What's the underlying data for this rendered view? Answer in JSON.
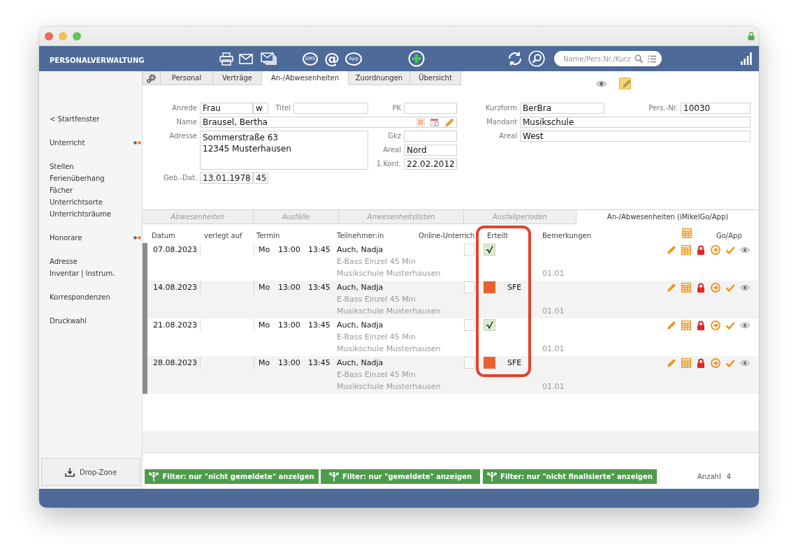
{
  "header": {
    "title": "PERSONALVERWALTUNG",
    "sms_label": "SMS",
    "at_symbol": "@",
    "app_label": "App",
    "search": {
      "placeholder": "Name/Pers.Nr./Kurz"
    }
  },
  "tabs": [
    {
      "label": "Personal",
      "selected": false
    },
    {
      "label": "Verträge",
      "selected": false
    },
    {
      "label": "An-/Abwesenheiten",
      "selected": true
    },
    {
      "label": "Zuordnungen",
      "selected": false
    },
    {
      "label": "Übersicht",
      "selected": false
    }
  ],
  "form": {
    "anrede": {
      "label": "Anrede",
      "value": "Frau"
    },
    "geschlecht": {
      "value": "w"
    },
    "titel": {
      "label": "Titel"
    },
    "pk": {
      "label": "PK"
    },
    "kurzform": {
      "label": "Kurzform",
      "value": "BerBra"
    },
    "pers_nr": {
      "label": "Pers.-Nr.",
      "value": "10030"
    },
    "name": {
      "label": "Name",
      "value": "Brausel, Bertha"
    },
    "mandant": {
      "label": "Mandant",
      "value": "Musikschule"
    },
    "adresse": {
      "label": "Adresse",
      "lines": [
        "Sommerstraße 63",
        "12345 Musterhausen"
      ]
    },
    "gkz": {
      "label": "Gkz"
    },
    "areal": {
      "label": "Areal",
      "value": "Nord"
    },
    "areal_2": {
      "label": "Areal",
      "value": "West"
    },
    "erster_kontakt": {
      "label": "1.Kont.",
      "value": "22.02.2012"
    },
    "geburtsdatum": {
      "label": "Geb.-Dat.",
      "value": "13.01.1978"
    },
    "alter": {
      "value": "45"
    }
  },
  "sidebar": {
    "groups": [
      [
        {
          "label": "< Startfenster",
          "dots": false
        }
      ],
      [
        {
          "label": "Unterricht",
          "dots": true
        }
      ],
      [
        {
          "label": "Stellen",
          "dots": false
        },
        {
          "label": "Ferienüberhang",
          "dots": false
        },
        {
          "label": "Fächer",
          "dots": false
        },
        {
          "label": "Unterrichtsorte",
          "dots": false
        },
        {
          "label": "Unterrichtsräume",
          "dots": false
        }
      ],
      [
        {
          "label": "Honorare",
          "dots": true
        }
      ],
      [
        {
          "label": "Adresse",
          "dots": false
        },
        {
          "label": "Inventar | Instrum.",
          "dots": false
        }
      ],
      [
        {
          "label": "Korrespondenzen",
          "dots": false
        }
      ],
      [
        {
          "label": "Druckwahl",
          "dots": false
        }
      ]
    ],
    "drop_zone": "Drop-Zone"
  },
  "subtabs": [
    {
      "label": "Abwesenheiten",
      "selected": false
    },
    {
      "label": "Ausfälle",
      "selected": false
    },
    {
      "label": "Anwesenheitslisten",
      "selected": false
    },
    {
      "label": "Ausfallperioden",
      "selected": false
    },
    {
      "label": "An-/Abwesenheiten (iMikelGo/App)",
      "selected": true
    }
  ],
  "table": {
    "columns": [
      "Datum",
      "verlegt auf",
      "Termin",
      "Teilnehmer:in",
      "Online-Unterrich",
      "Erteilt",
      "Bemerkungen",
      "Go/App"
    ],
    "rows": [
      {
        "date": "07.08.2023",
        "weekday": "Mo",
        "start": "13:00",
        "end": "13:45",
        "participant": "Auch, Nadja",
        "course": "E-Bass Einzel 45 Min",
        "location": "Musikschule Musterhausen",
        "online": false,
        "erteilt": true,
        "remark": "01.01"
      },
      {
        "date": "14.08.2023",
        "weekday": "Mo",
        "start": "13:00",
        "end": "13:45",
        "participant": "Auch, Nadja",
        "course": "E-Bass Einzel 45 Min",
        "location": "Musikschule Musterhausen",
        "online": false,
        "erteilt": false,
        "code": "SFE",
        "remark": "01.01"
      },
      {
        "date": "21.08.2023",
        "weekday": "Mo",
        "start": "13:00",
        "end": "13:45",
        "participant": "Auch, Nadja",
        "course": "E-Bass Einzel 45 Min",
        "location": "Musikschule Musterhausen",
        "online": false,
        "erteilt": true,
        "remark": "01.01"
      },
      {
        "date": "28.08.2023",
        "weekday": "Mo",
        "start": "13:00",
        "end": "13:45",
        "participant": "Auch, Nadja",
        "course": "E-Bass Einzel 45 Min",
        "location": "Musikschule Musterhausen",
        "online": false,
        "erteilt": false,
        "code": "SFE",
        "remark": "01.01"
      }
    ]
  },
  "filters": [
    "Filter: nur \"nicht gemeldete\" anzeigen",
    "Filter: nur \"gemeldete\" anzeigen",
    "Filter: nur \"nicht finalisierte\" anzeigen"
  ],
  "count": {
    "label": "Anzahl",
    "value": "4"
  }
}
